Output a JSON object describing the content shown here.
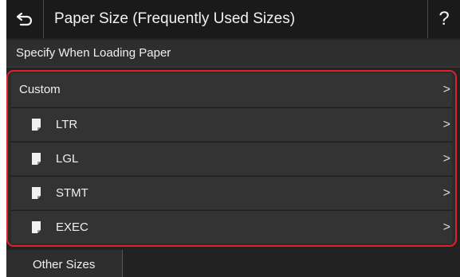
{
  "header": {
    "title": "Paper Size (Frequently Used Sizes)",
    "back_icon": "back-arrow-icon",
    "help_label": "?"
  },
  "subheader": {
    "text": "Specify When Loading Paper"
  },
  "list": {
    "items": [
      {
        "label": "Custom",
        "has_paper_icon": false
      },
      {
        "label": "LTR",
        "has_paper_icon": true
      },
      {
        "label": "LGL",
        "has_paper_icon": true
      },
      {
        "label": "STMT",
        "has_paper_icon": true
      },
      {
        "label": "EXEC",
        "has_paper_icon": true
      }
    ],
    "chevron": ">"
  },
  "bottom": {
    "tab_label": "Other Sizes"
  },
  "colors": {
    "background": "#222222",
    "row": "#333333",
    "highlight_border": "#e0202a",
    "text": "#f0f0f0"
  }
}
